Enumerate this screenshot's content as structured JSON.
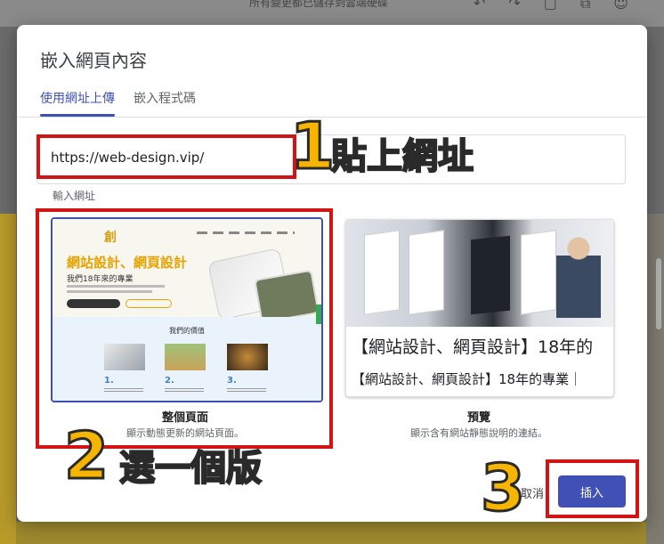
{
  "background": {
    "hint_text": "所有變更都已儲存到雲端硬碟",
    "toolbar_icons": [
      "undo-icon",
      "redo-icon",
      "preview-icon",
      "link-icon",
      "share-icon"
    ]
  },
  "dialog": {
    "title": "嵌入網頁內容",
    "tabs": [
      {
        "label": "使用網址上傳",
        "active": true
      },
      {
        "label": "嵌入程式碼",
        "active": false
      }
    ],
    "url_input": {
      "value": "https://web-design.vip/",
      "label": "輸入網址"
    },
    "options": {
      "full_page": {
        "label": "整個頁面",
        "description": "顯示動態更新的網站頁面。",
        "thumbnail": {
          "logo": "創",
          "hero_title": "網站設計、網頁設計",
          "hero_sub": "我們18年來的專業",
          "section_title": "我們的價值",
          "values": [
            "1.",
            "2.",
            "3."
          ]
        }
      },
      "preview": {
        "label": "預覽",
        "description": "顯示含有網站靜態說明的連結。",
        "title_line1": "【網站設計、網頁設計】18年的",
        "title_line2": "【網站設計、網頁設計】18年的專業｜"
      }
    },
    "buttons": {
      "cancel": "取消",
      "insert": "插入"
    }
  },
  "annotations": {
    "step1_number": "1",
    "step1_text": "貼上網址",
    "step2_number": "2",
    "step2_text": "選一個版",
    "step3_number": "3"
  },
  "colors": {
    "accent": "#3f51b5",
    "highlight_red": "#d31414",
    "callout_yellow": "#f7b500"
  }
}
